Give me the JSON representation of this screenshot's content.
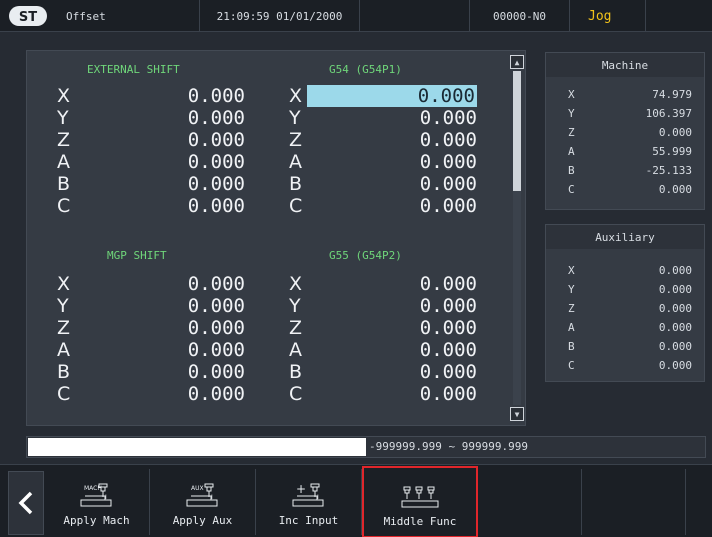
{
  "header": {
    "logo": "ST",
    "title": "Offset",
    "datetime": "21:09:59 01/01/2000",
    "program": "00000-N0",
    "mode": "Jog"
  },
  "sections": {
    "external_shift": {
      "title": "EXTERNAL SHIFT",
      "axes": [
        {
          "axis": "X",
          "value": "0.000"
        },
        {
          "axis": "Y",
          "value": "0.000"
        },
        {
          "axis": "Z",
          "value": "0.000"
        },
        {
          "axis": "A",
          "value": "0.000"
        },
        {
          "axis": "B",
          "value": "0.000"
        },
        {
          "axis": "C",
          "value": "0.000"
        }
      ]
    },
    "g54": {
      "title": "G54 (G54P1)",
      "axes": [
        {
          "axis": "X",
          "value": "0.000"
        },
        {
          "axis": "Y",
          "value": "0.000"
        },
        {
          "axis": "Z",
          "value": "0.000"
        },
        {
          "axis": "A",
          "value": "0.000"
        },
        {
          "axis": "B",
          "value": "0.000"
        },
        {
          "axis": "C",
          "value": "0.000"
        }
      ]
    },
    "mgp_shift": {
      "title": "MGP SHIFT",
      "axes": [
        {
          "axis": "X",
          "value": "0.000"
        },
        {
          "axis": "Y",
          "value": "0.000"
        },
        {
          "axis": "Z",
          "value": "0.000"
        },
        {
          "axis": "A",
          "value": "0.000"
        },
        {
          "axis": "B",
          "value": "0.000"
        },
        {
          "axis": "C",
          "value": "0.000"
        }
      ]
    },
    "g55": {
      "title": "G55 (G54P2)",
      "axes": [
        {
          "axis": "X",
          "value": "0.000"
        },
        {
          "axis": "Y",
          "value": "0.000"
        },
        {
          "axis": "Z",
          "value": "0.000"
        },
        {
          "axis": "A",
          "value": "0.000"
        },
        {
          "axis": "B",
          "value": "0.000"
        },
        {
          "axis": "C",
          "value": "0.000"
        }
      ]
    }
  },
  "machine": {
    "title": "Machine",
    "rows": [
      {
        "axis": "X",
        "value": "74.979"
      },
      {
        "axis": "Y",
        "value": "106.397"
      },
      {
        "axis": "Z",
        "value": "0.000"
      },
      {
        "axis": "A",
        "value": "55.999"
      },
      {
        "axis": "B",
        "value": "-25.133"
      },
      {
        "axis": "C",
        "value": "0.000"
      }
    ]
  },
  "auxiliary": {
    "title": "Auxiliary",
    "rows": [
      {
        "axis": "X",
        "value": "0.000"
      },
      {
        "axis": "Y",
        "value": "0.000"
      },
      {
        "axis": "Z",
        "value": "0.000"
      },
      {
        "axis": "A",
        "value": "0.000"
      },
      {
        "axis": "B",
        "value": "0.000"
      },
      {
        "axis": "C",
        "value": "0.000"
      }
    ]
  },
  "input": {
    "value": "",
    "range": "-999999.999 ~ 999999.999"
  },
  "softkeys": [
    {
      "label": "Apply Mach",
      "icon": "apply-mach-icon",
      "icon_text": "MACH",
      "selected": false
    },
    {
      "label": "Apply Aux",
      "icon": "apply-aux-icon",
      "icon_text": "AUX",
      "selected": false
    },
    {
      "label": "Inc Input",
      "icon": "inc-input-icon",
      "icon_text": "+",
      "selected": false
    },
    {
      "label": "Middle Func",
      "icon": "middle-func-icon",
      "icon_text": "",
      "selected": true
    }
  ],
  "colors": {
    "section_title": "#6fd67a",
    "mode_text": "#f3c31a",
    "selected_cell": "#9cd9ea",
    "selected_border": "#e0262b"
  }
}
